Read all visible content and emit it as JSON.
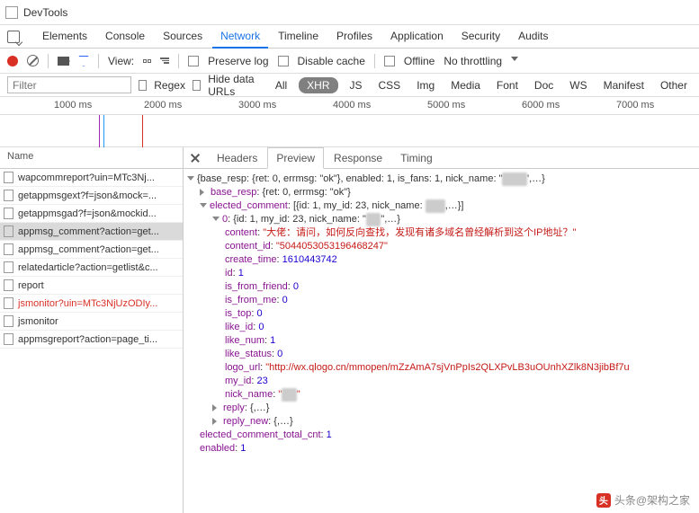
{
  "window": {
    "title": "DevTools"
  },
  "tabs": [
    "Elements",
    "Console",
    "Sources",
    "Network",
    "Timeline",
    "Profiles",
    "Application",
    "Security",
    "Audits"
  ],
  "active_tab": "Network",
  "toolbar": {
    "view_label": "View:",
    "preserve_log": "Preserve log",
    "disable_cache": "Disable cache",
    "offline": "Offline",
    "throttling": "No throttling"
  },
  "filterbar": {
    "placeholder": "Filter",
    "regex": "Regex",
    "hide_data_urls": "Hide data URLs",
    "types": [
      "All",
      "XHR",
      "JS",
      "CSS",
      "Img",
      "Media",
      "Font",
      "Doc",
      "WS",
      "Manifest",
      "Other"
    ],
    "active_type": "XHR"
  },
  "timeline_ticks": [
    "1000 ms",
    "2000 ms",
    "3000 ms",
    "4000 ms",
    "5000 ms",
    "6000 ms",
    "7000 ms"
  ],
  "sidebar": {
    "heading": "Name",
    "items": [
      {
        "name": "wapcommreport?uin=MTc3Nj..."
      },
      {
        "name": "getappmsgext?f=json&mock=..."
      },
      {
        "name": "getappmsgad?f=json&mockid..."
      },
      {
        "name": "appmsg_comment?action=get...",
        "selected": true
      },
      {
        "name": "appmsg_comment?action=get..."
      },
      {
        "name": "relatedarticle?action=getlist&c..."
      },
      {
        "name": "report"
      },
      {
        "name": "jsmonitor?uin=MTc3NjUzODIy...",
        "error": true
      },
      {
        "name": "jsmonitor"
      },
      {
        "name": "appmsgreport?action=page_ti..."
      }
    ]
  },
  "detail_tabs": [
    "Headers",
    "Preview",
    "Response",
    "Timing"
  ],
  "active_detail_tab": "Preview",
  "preview": {
    "top_line_prefix": "{base_resp: {ret: 0, errmsg: \"ok\"}, enabled: 1, is_fans: 1, nick_name: \"",
    "top_line_suffix": "',…}",
    "base_resp": "{ret: 0, errmsg: \"ok\"}",
    "elected_header_prefix": "[{id: 1, my_id: 23, nick_name: ",
    "elected_header_suffix": ",…}]",
    "item0_header_prefix": "{id: 1, my_id: 23, nick_name: \"",
    "item0_header_suffix": "\",…}",
    "content": "\"大佬：请问，如何反向查找，发现有诸多域名曾经解析到这个IP地址？\"",
    "content_id": "\"5044053053196468247\"",
    "create_time": "1610443742",
    "id": "1",
    "is_from_friend": "0",
    "is_from_me": "0",
    "is_top": "0",
    "like_id": "0",
    "like_num": "1",
    "like_status": "0",
    "logo_url": "\"http://wx.qlogo.cn/mmopen/mZzAmA7sjVnPpIs2QLXPvLB3uOUnhXZlk8N3jibBf7u",
    "my_id": "23",
    "reply": "{,…}",
    "reply_new": "{,…}",
    "elected_total": "1",
    "enabled": "1"
  },
  "watermark": {
    "text": "头条@架构之家"
  }
}
